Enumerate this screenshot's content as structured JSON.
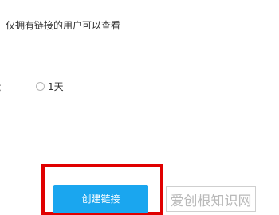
{
  "share_settings": {
    "access_note": "仅拥有链接的用户可以查看",
    "partial_label": "：",
    "expiry_option": "1天"
  },
  "actions": {
    "create_link_label": "创建链接"
  },
  "watermark": {
    "text": "爱创根知识网"
  },
  "colors": {
    "button_bg": "#1aa6ef",
    "highlight": "#e00000"
  }
}
